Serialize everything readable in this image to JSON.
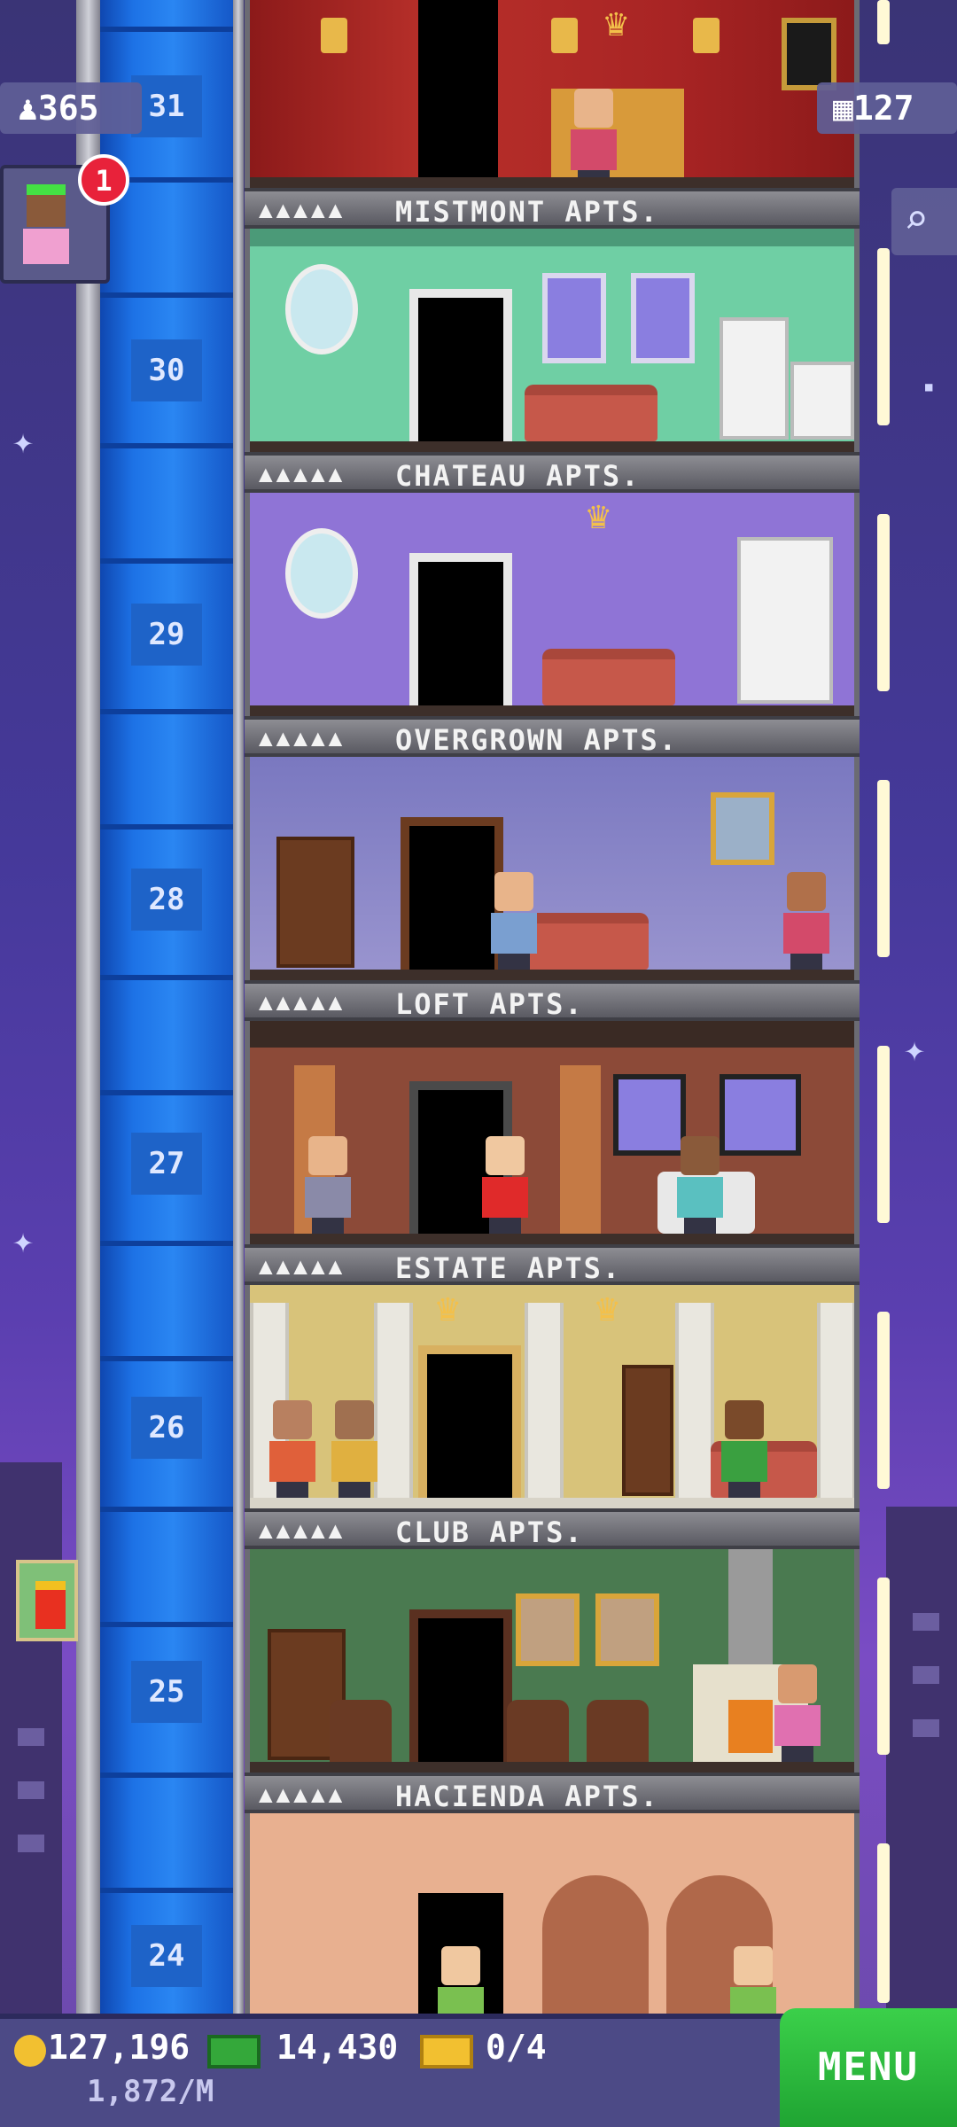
{
  "hud": {
    "population": "365",
    "floors": "127",
    "notification_count": "1"
  },
  "floors": [
    {
      "number": "31",
      "name": ""
    },
    {
      "number": "30",
      "name": "MISTMONT APTS."
    },
    {
      "number": "29",
      "name": "CHATEAU APTS."
    },
    {
      "number": "28",
      "name": "OVERGROWN APTS."
    },
    {
      "number": "27",
      "name": "LOFT APTS."
    },
    {
      "number": "26",
      "name": "ESTATE APTS."
    },
    {
      "number": "25",
      "name": "CLUB APTS."
    },
    {
      "number": "24",
      "name": "HACIENDA APTS."
    }
  ],
  "labels": {
    "l0": "MISTMONT APTS.",
    "l1": "CHATEAU APTS.",
    "l2": "OVERGROWN APTS.",
    "l3": "LOFT APTS.",
    "l4": "ESTATE APTS.",
    "l5": "CLUB APTS.",
    "l6": "HACIENDA APTS."
  },
  "bottom_bar": {
    "coins": "127,196",
    "bux": "14,430",
    "tickets": "0/4",
    "income": "1,872/M",
    "menu_label": "MENU"
  },
  "colors": {
    "elevator": "#1d72e6",
    "menu_green": "#2bc03c",
    "badge_red": "#e8223a",
    "sky": "#45399a"
  },
  "icons": [
    "person-icon",
    "building-icon",
    "search-icon",
    "coin-icon",
    "bux-icon",
    "ticket-icon",
    "fries-icon"
  ]
}
